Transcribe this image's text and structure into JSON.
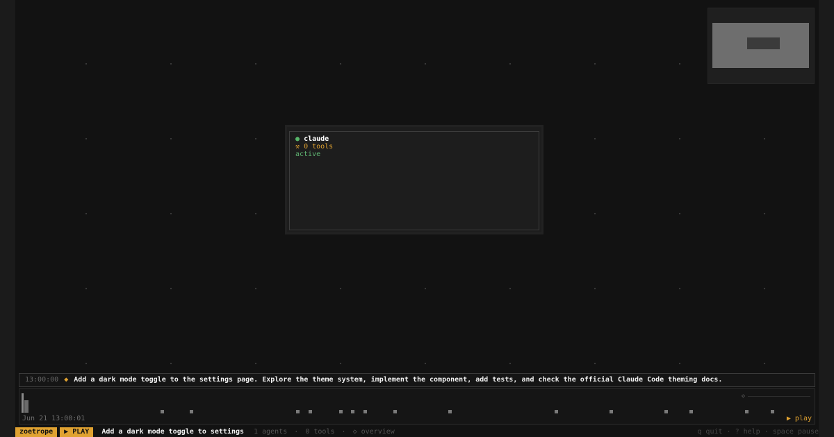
{
  "colors": {
    "accent": "#e0a231",
    "active_green": "#58b86a",
    "background": "#121212"
  },
  "agent": {
    "status_dot_icon": "circle-icon",
    "name": "claude",
    "tools_icon": "wrench-icon",
    "tools": "0 tools",
    "status": "active"
  },
  "task": {
    "time": "13:00:00",
    "icon": "diamond-icon",
    "text": "Add a dark mode toggle to the settings page. Explore the theme system, implement the component, add tests, and check the official Claude Code theming docs."
  },
  "timeline": {
    "timestamp": "Jun 21 13:00:01",
    "cursor_icon": "diamond-outline-icon",
    "play_label": "▶ play"
  },
  "statusbar": {
    "app": "zoetrope",
    "mode": "▶ PLAY",
    "command": "Add a dark mode toggle to settings",
    "agents": "1 agents",
    "tools": "0 tools",
    "view": "◇ overview",
    "keys": "q quit · ? help · space pause"
  }
}
